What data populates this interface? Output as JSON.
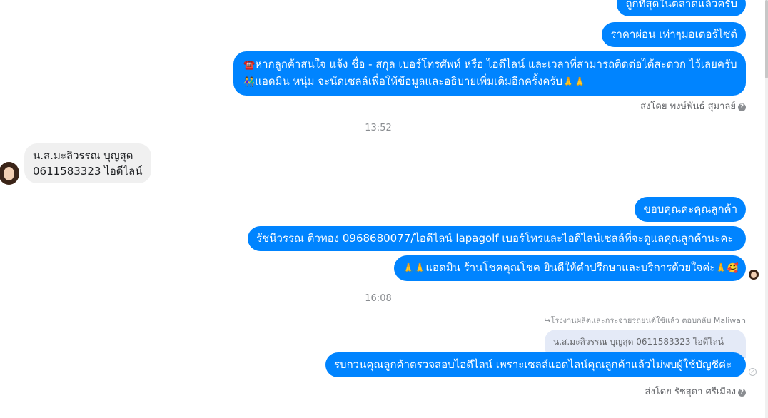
{
  "messages": {
    "out_top_partial": "ถูกที่สุดในตลาดแล้วครับ",
    "out_installment": "ราคาผ่อน เท่าๆมอเตอร์ไซต์",
    "out_contact_line1_emoji": "☎️",
    "out_contact_line1": "หากลูกค้าสนใจ แจ้ง ชื่อ - สกุล เบอร์โทรศัพท์ หรือ ไอดีไลน์ และเวลาที่สามารถติดต่อได้สะดวก ไว้เลยครับ",
    "out_contact_line2_emoji": "👫",
    "out_contact_line2": "แอดมิน หนุ่ม จะนัดเซลล์เพื่อให้ข้อมูลและอธิบายเพิ่มเติมอีกครั้งครับ",
    "out_contact_line2_end": "🙏🙏",
    "sent_by_1": "ส่งโดย พงษ์พันธ์ สุมาลย์",
    "time_1": "13:52",
    "in_line1": "น.ส.มะลิวรรณ  บุญสุด",
    "in_line2": "0611583323  ไอดีไลน์",
    "out_thanks": "ขอบคุณค่ะคุณลูกค้า",
    "out_sales": "รัชนีวรรณ ติวทอง    0968680077/ไอดีไลน์ lapagolf  เบอร์โทรและไอดีไลน์เซลล์ที่จะดูแลคุณลูกค้านะคะ",
    "out_admin_start": "🙏🙏",
    "out_admin": "แอดมิน ร้านโชคคุณโชค ยินดีให้คำปรึกษาและบริการด้วยใจค่ะ",
    "out_admin_end": "🙏🥰",
    "time_2": "16:08",
    "reply_header": "↪โรงงานผลิตและกระจายรถยนต์ใช้แล้ว ตอบกลับ Maliwan",
    "quoted_text": "น.ส.มะลิวรรณ บุญสุด 0611583323 ไอดีไลน์",
    "out_check": "รบกวนคุณลูกค้าตรวจสอบไอดีไลน์  เพราะเซลล์แอดไลน์คุณลูกค้าแล้วไม่พบผู้ใช้บัญชีค่ะ",
    "sent_by_2": "ส่งโดย รัชสุดา ศรีเมือง"
  },
  "icons": {
    "help": "?",
    "seen": "✓"
  },
  "colors": {
    "outgoing_bubble": "#0084ff",
    "incoming_bubble": "#f0f0f0",
    "quoted_bubble": "#e4eaf7"
  }
}
